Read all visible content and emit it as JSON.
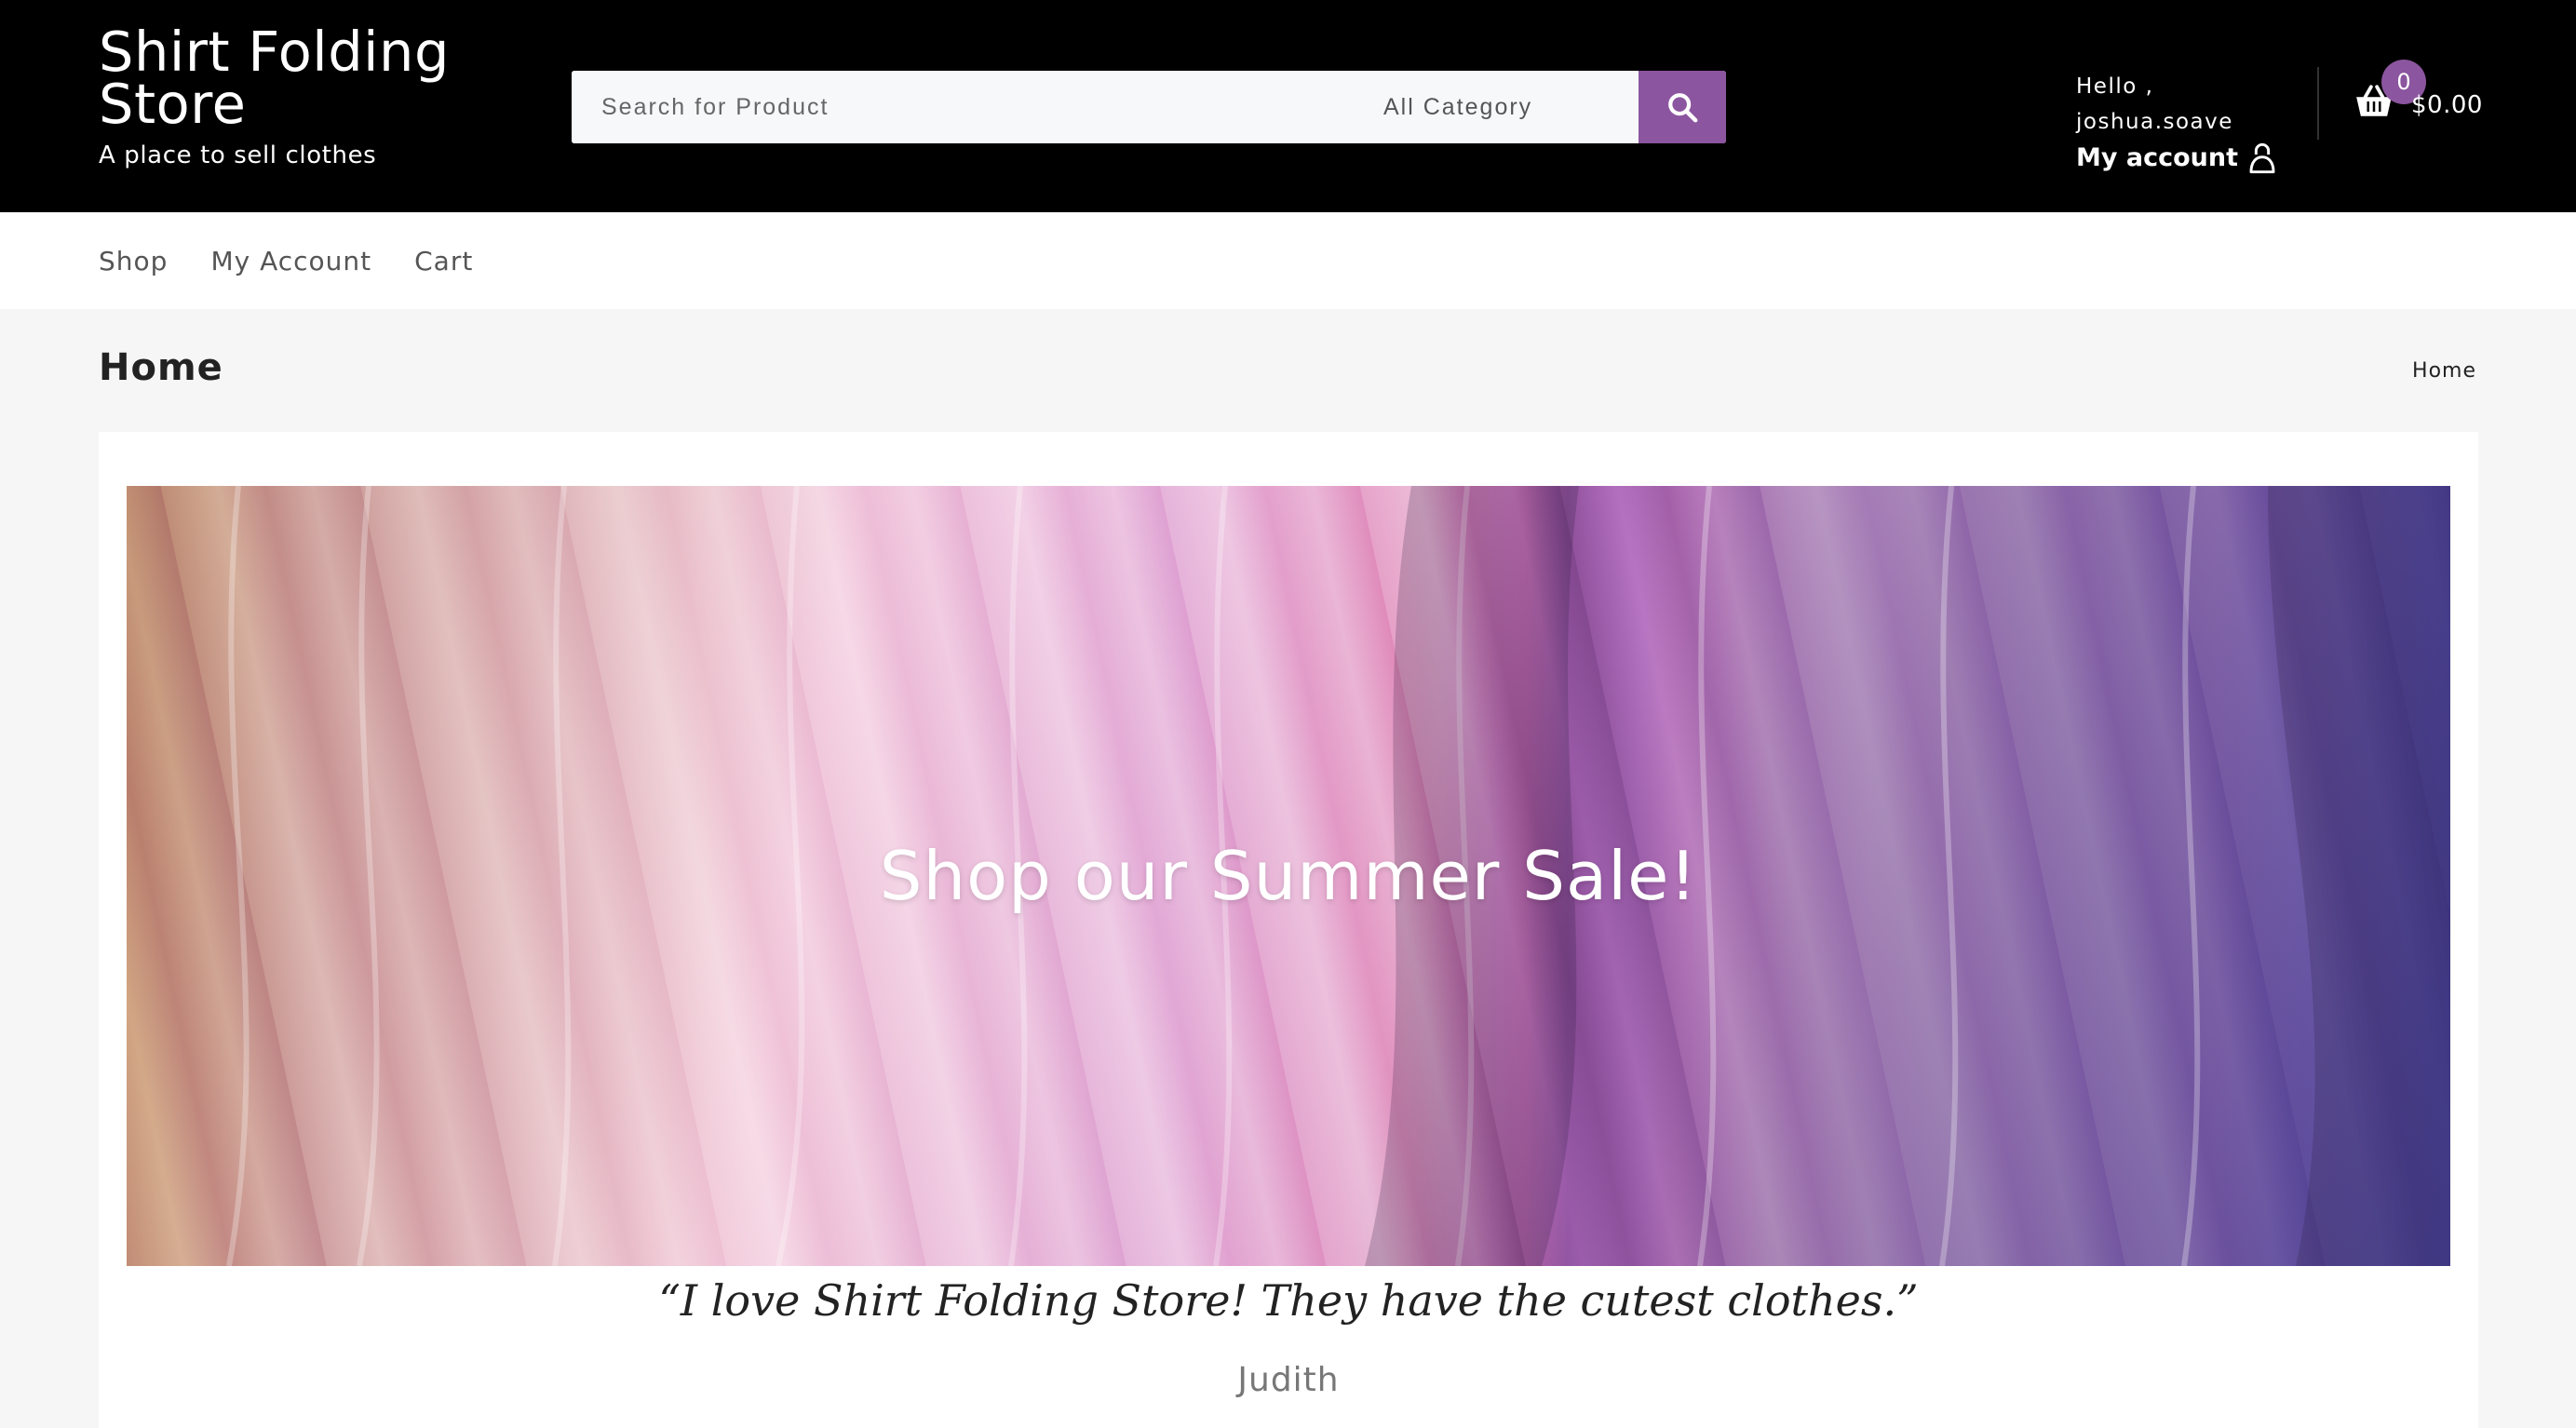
{
  "header": {
    "brand_title": "Shirt Folding Store",
    "brand_tagline": "A place to sell clothes",
    "search": {
      "placeholder": "Search for Product",
      "category": "All Category",
      "button_icon": "search-icon"
    },
    "account": {
      "greeting": "Hello , joshua.soave",
      "link_label": "My account",
      "icon": "user-icon"
    },
    "cart": {
      "count": "0",
      "total": "$0.00",
      "icon": "basket-icon"
    }
  },
  "nav": {
    "items": [
      "Shop",
      "My Account",
      "Cart"
    ]
  },
  "page": {
    "title": "Home",
    "breadcrumb": "Home"
  },
  "hero": {
    "headline": "Shop our Summer Sale!"
  },
  "testimonial": {
    "quote": "“I love Shirt Folding Store! They have the cutest clothes.”",
    "author": "Judith"
  },
  "colors": {
    "accent": "#8b559f",
    "header_bg": "#000000",
    "page_bg": "#f6f6f6"
  }
}
